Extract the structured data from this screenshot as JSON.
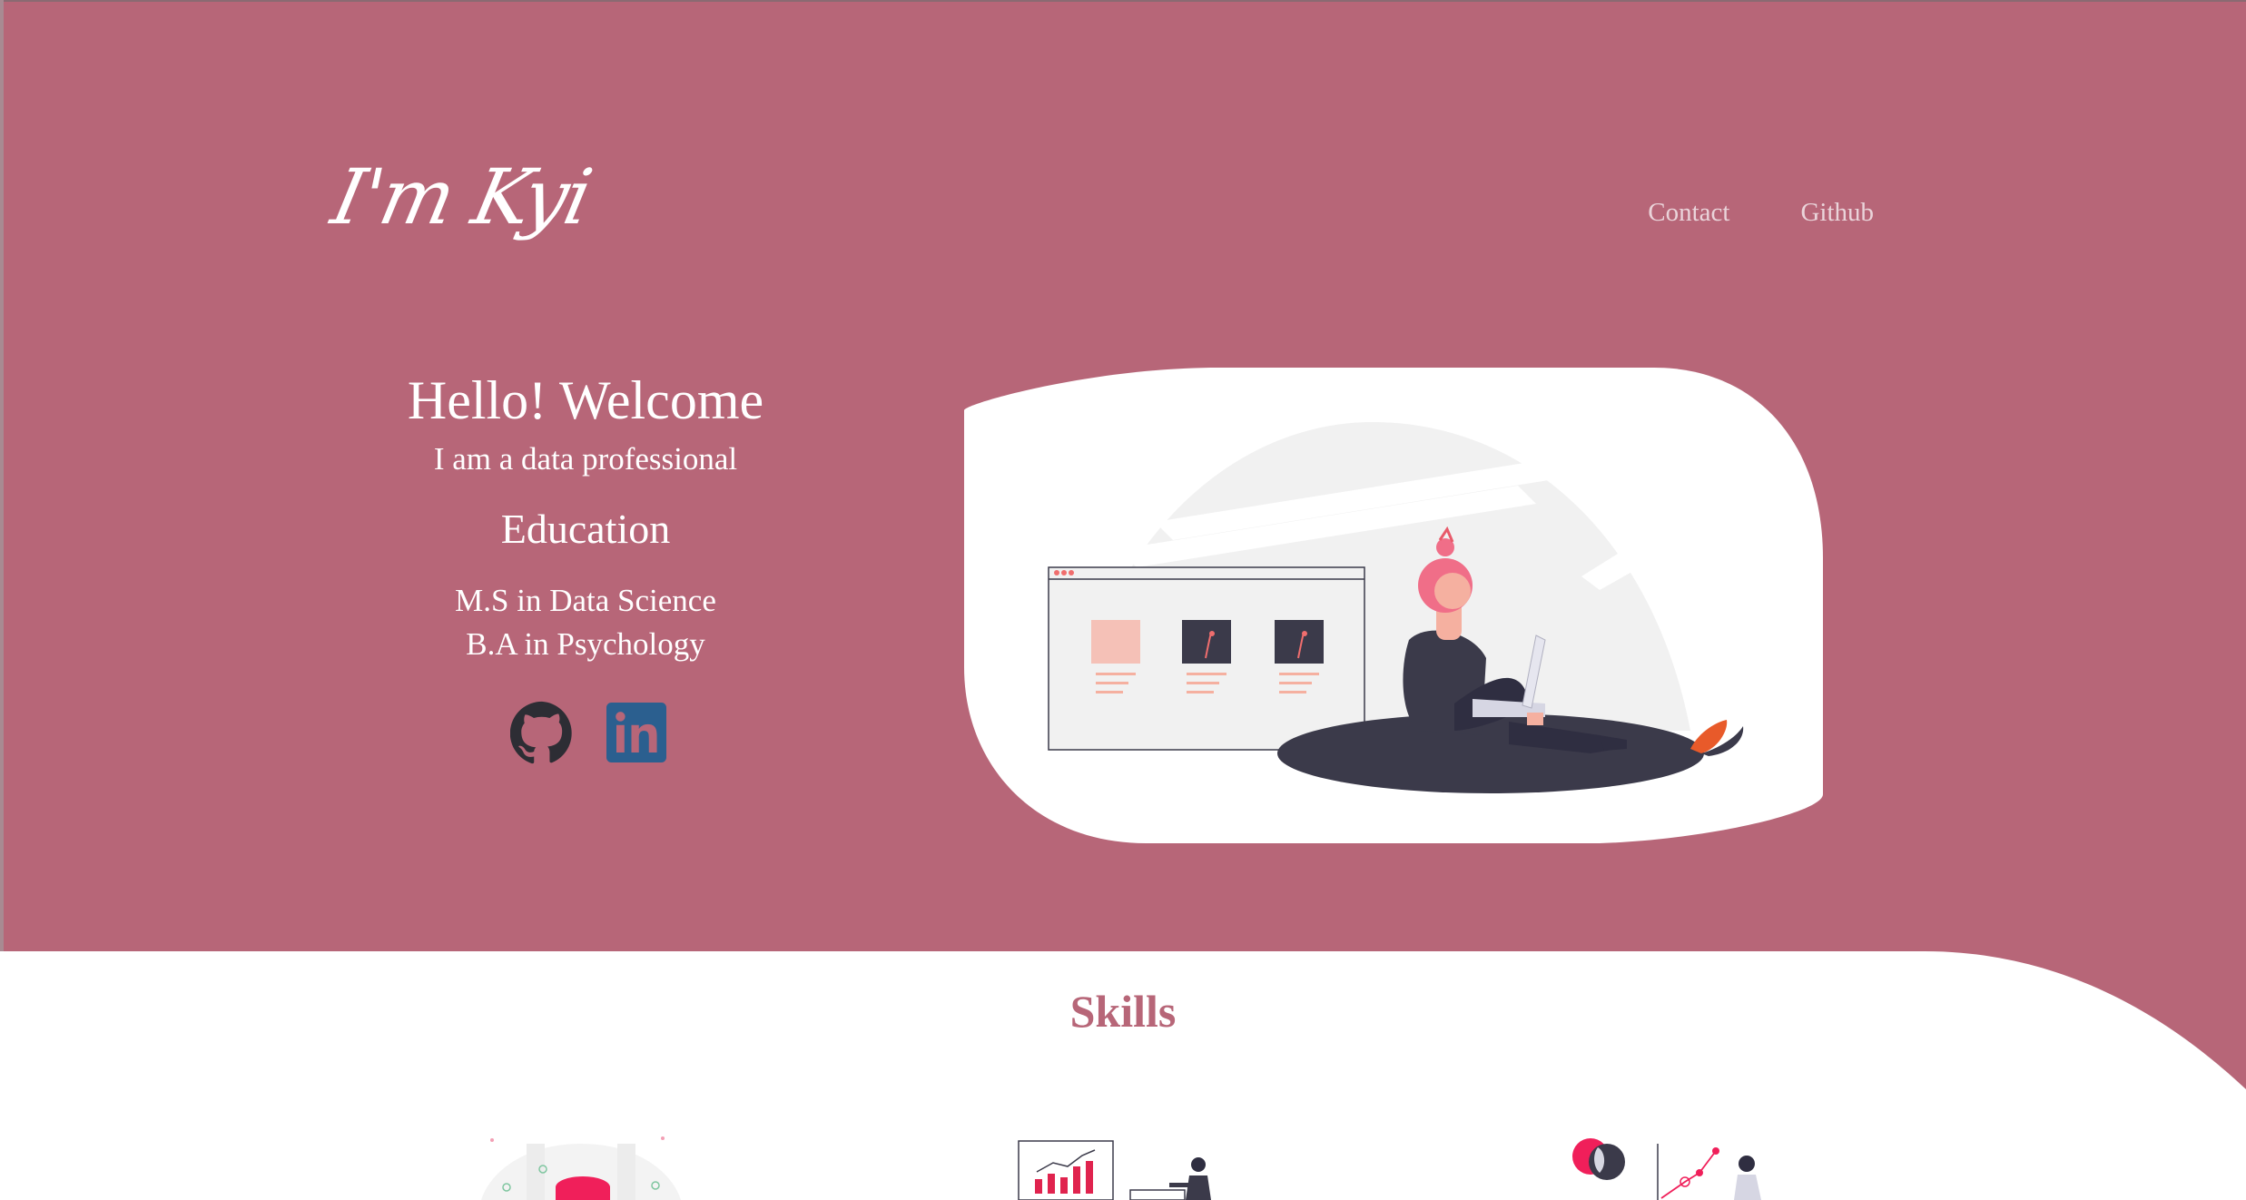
{
  "brand": {
    "logo_text": "I'm Kyi"
  },
  "nav": {
    "items": [
      {
        "label": "Contact"
      },
      {
        "label": "Github"
      }
    ]
  },
  "intro": {
    "greeting": "Hello! Welcome",
    "tagline": "I am a data professional",
    "education_heading": "Education",
    "degrees": [
      "M.S in Data Science",
      "B.A in Psychology"
    ]
  },
  "socials": [
    {
      "icon": "github-icon"
    },
    {
      "icon": "linkedin-icon"
    }
  ],
  "skills": {
    "title": "Skills"
  },
  "colors": {
    "background": "#b76678",
    "card": "#ffffff",
    "accent": "#f06e6e",
    "dark": "#3b3a4a",
    "linkedin": "#2b5f8f"
  }
}
